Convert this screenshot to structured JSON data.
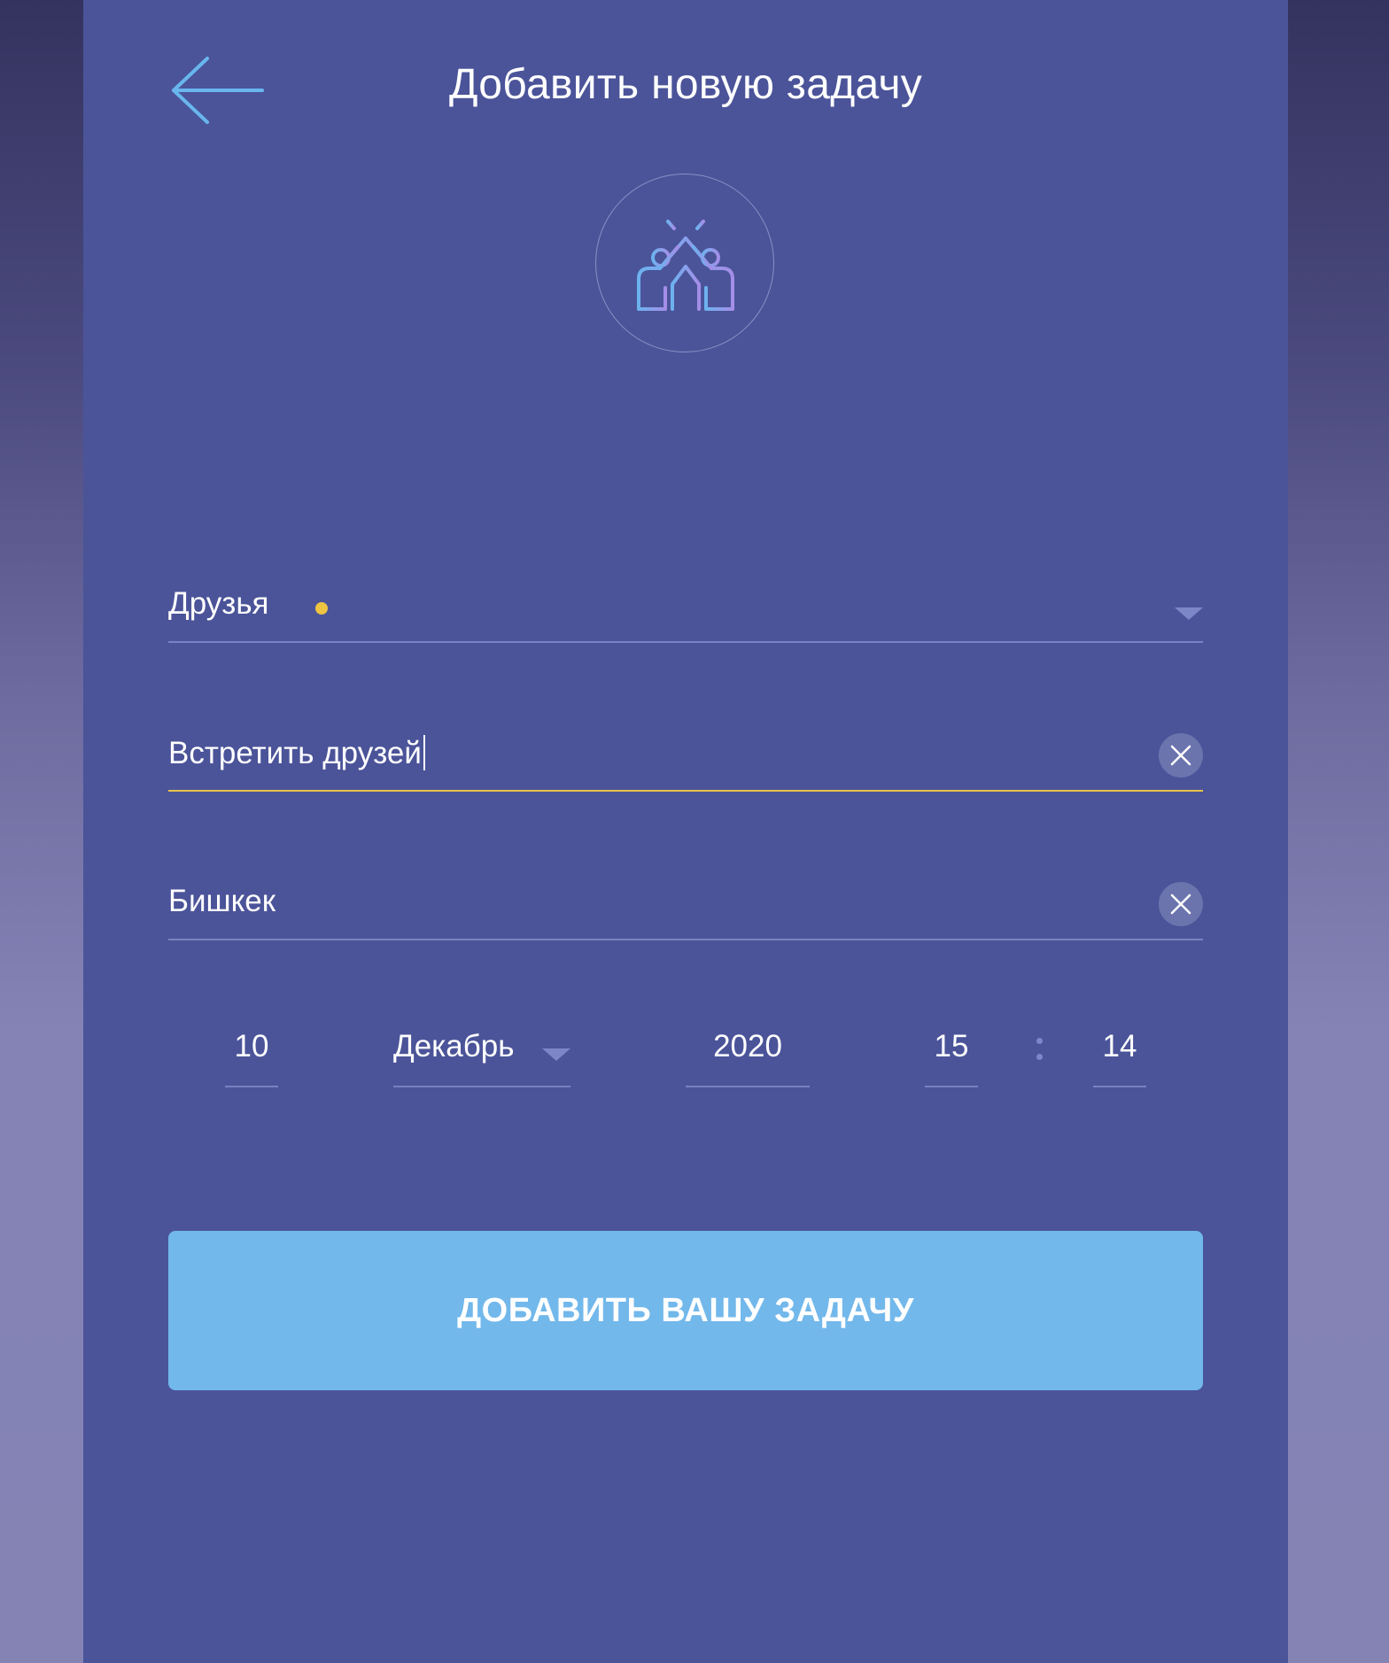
{
  "header": {
    "title": "Добавить новую задачу",
    "back_icon": "arrow-left-icon"
  },
  "category_avatar": {
    "icon": "high-five-icon"
  },
  "form": {
    "category": {
      "value": "Друзья",
      "dot_color": "#eec443",
      "arrow_icon": "caret-down-icon"
    },
    "task_name": {
      "value": "Встретить друзей",
      "clear_icon": "close-icon"
    },
    "location": {
      "value": "Бишкек",
      "clear_icon": "close-icon"
    },
    "datetime": {
      "day": "10",
      "month": "Декабрь",
      "year": "2020",
      "hour": "15",
      "minute": "14"
    }
  },
  "submit": {
    "label": "ДОБАВИТЬ ВАШУ ЗАДАЧУ"
  },
  "colors": {
    "panel": "#4b5499",
    "accent_button": "#72b8eb",
    "active_underline": "#e8c24a",
    "icon_blue": "#6db2ef",
    "icon_violet": "#a48ee8"
  }
}
